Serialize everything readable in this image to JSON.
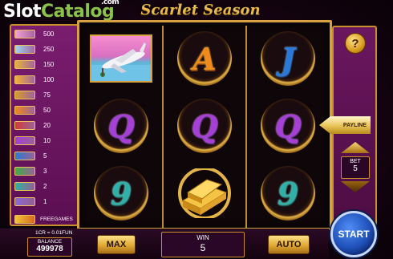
{
  "watermark": {
    "slot": "Slot",
    "catalog": "Catalog",
    "com": ".com"
  },
  "game_title": "Scarlet Season",
  "paytable": {
    "rows": [
      {
        "icon": "plane-symbol-icon",
        "value": "500",
        "color": "#f5a0d6"
      },
      {
        "icon": "yacht-symbol-icon",
        "value": "250",
        "color": "#9fd5f2"
      },
      {
        "icon": "car-symbol-icon",
        "value": "150",
        "color": "#e9b23c"
      },
      {
        "icon": "gold-bars-symbol-icon",
        "value": "100",
        "color": "#f2b233"
      },
      {
        "icon": "coins-symbol-icon",
        "value": "75",
        "color": "#d89b2c"
      },
      {
        "icon": "a-symbol-icon",
        "value": "50",
        "color": "#f08a1c"
      },
      {
        "icon": "k-symbol-icon",
        "value": "20",
        "color": "#d13a3a"
      },
      {
        "icon": "q-symbol-icon",
        "value": "10",
        "color": "#a53fd6"
      },
      {
        "icon": "j-symbol-icon",
        "value": "5",
        "color": "#2979d9"
      },
      {
        "icon": "ten-symbol-icon",
        "value": "3",
        "color": "#3fae4a"
      },
      {
        "icon": "nine-symbol-icon",
        "value": "2",
        "color": "#2fb0a8"
      },
      {
        "icon": "eight-symbol-icon",
        "value": "1",
        "color": "#8a6ad6"
      }
    ],
    "freegames_label": "FREEGAMES"
  },
  "reels": [
    [
      {
        "type": "plane"
      },
      {
        "type": "letter",
        "glyph": "Q",
        "cls": "Q"
      },
      {
        "type": "letter",
        "glyph": "9",
        "cls": "N9"
      }
    ],
    [
      {
        "type": "letter",
        "glyph": "A",
        "cls": "A"
      },
      {
        "type": "letter",
        "glyph": "Q",
        "cls": "Q"
      },
      {
        "type": "gold"
      }
    ],
    [
      {
        "type": "letter",
        "glyph": "J",
        "cls": "J"
      },
      {
        "type": "letter",
        "glyph": "Q",
        "cls": "Q"
      },
      {
        "type": "letter",
        "glyph": "9",
        "cls": "N9"
      }
    ]
  ],
  "controls": {
    "help_label": "?",
    "payline_label": "PAYLINE",
    "bet_label": "BET",
    "bet_value": "5",
    "start_label": "START",
    "info_line": "1CR = 0.01FUN",
    "balance_label": "BALANCE",
    "balance_value": "499978",
    "max_label": "MAX",
    "win_label": "WIN",
    "win_value": "5",
    "auto_label": "AUTO"
  }
}
